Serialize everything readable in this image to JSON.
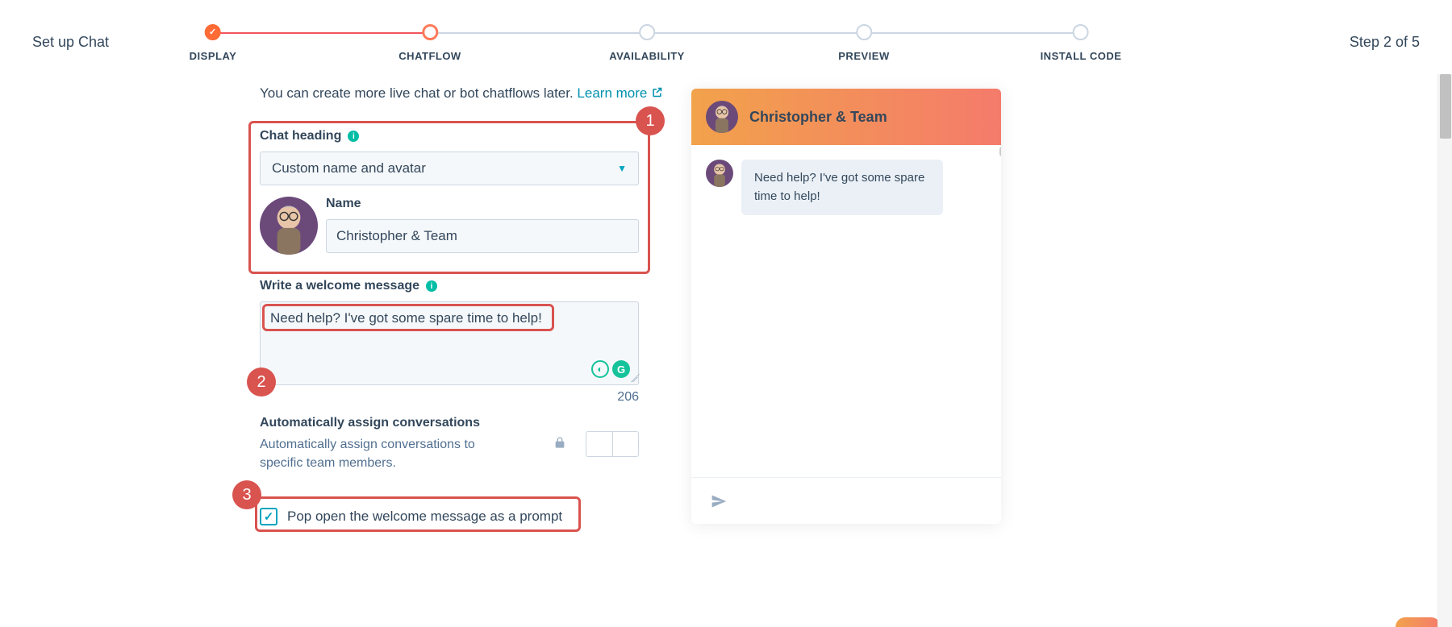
{
  "header": {
    "title": "Set up Chat",
    "step_text": "Step 2 of 5",
    "steps": [
      "DISPLAY",
      "CHATFLOW",
      "AVAILABILITY",
      "PREVIEW",
      "INSTALL CODE"
    ],
    "active_index": 1
  },
  "intro": {
    "text": "You can create more live chat or bot chatflows later. ",
    "learn_more": "Learn more"
  },
  "form": {
    "chat_heading_label": "Chat heading",
    "heading_select_value": "Custom name and avatar",
    "name_label": "Name",
    "name_value": "Christopher & Team",
    "welcome_label": "Write a welcome message",
    "welcome_value": "Need help? I've got some spare time to help!",
    "char_counter": "206",
    "auto_assign_title": "Automatically assign conversations",
    "auto_assign_sub": "Automatically assign conversations to specific team members.",
    "pop_open_label": "Pop open the welcome message as a prompt",
    "pop_open_checked": true
  },
  "preview": {
    "title": "Christopher & Team",
    "message": "Need help? I've got some spare time to help!"
  },
  "annotations": {
    "b1": "1",
    "b2": "2",
    "b3": "3"
  }
}
